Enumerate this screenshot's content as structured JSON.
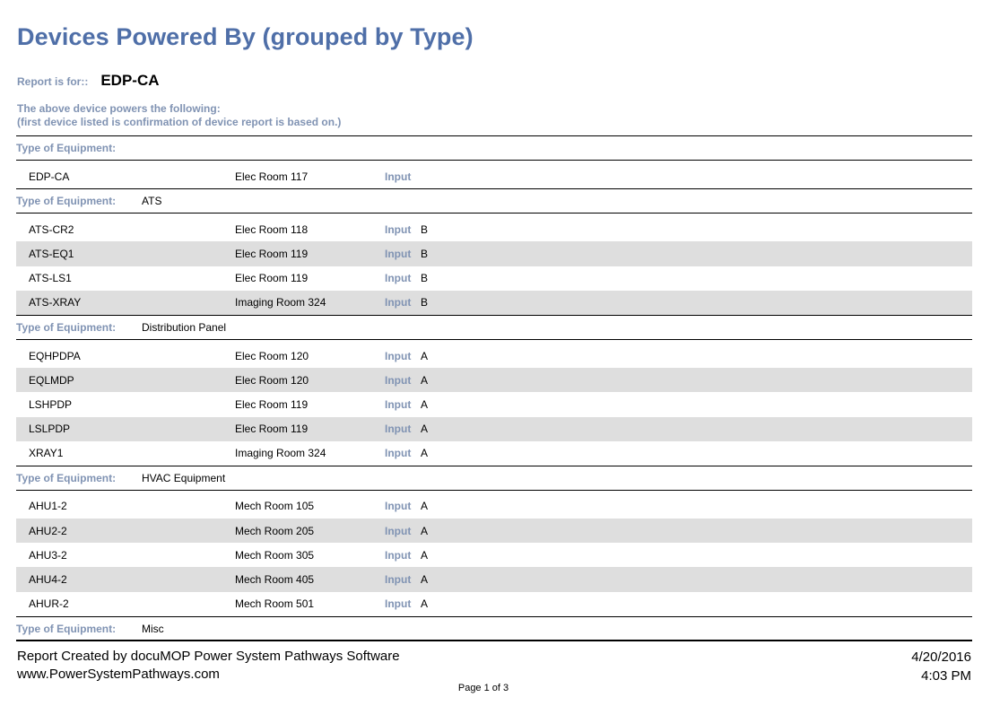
{
  "report": {
    "title": "Devices Powered By (grouped by Type)",
    "report_for_label": "Report is for::",
    "report_for_value": "EDP-CA",
    "note_line1": "The above device powers the following:",
    "note_line2": "(first device listed is confirmation of device report is based on.)"
  },
  "type_label": "Type of Equipment:",
  "input_label": "Input",
  "groups": [
    {
      "type": "",
      "rows": [
        {
          "name": "EDP-CA",
          "location": "Elec Room 117",
          "side": ""
        }
      ]
    },
    {
      "type": "ATS",
      "rows": [
        {
          "name": "ATS-CR2",
          "location": "Elec Room 118",
          "side": "B"
        },
        {
          "name": "ATS-EQ1",
          "location": "Elec Room 119",
          "side": "B"
        },
        {
          "name": "ATS-LS1",
          "location": "Elec Room 119",
          "side": "B"
        },
        {
          "name": "ATS-XRAY",
          "location": "Imaging Room 324",
          "side": "B"
        }
      ]
    },
    {
      "type": "Distribution Panel",
      "rows": [
        {
          "name": "EQHPDPA",
          "location": "Elec Room 120",
          "side": "A"
        },
        {
          "name": "EQLMDP",
          "location": "Elec Room 120",
          "side": "A"
        },
        {
          "name": "LSHPDP",
          "location": "Elec Room 119",
          "side": "A"
        },
        {
          "name": "LSLPDP",
          "location": "Elec Room 119",
          "side": "A"
        },
        {
          "name": "XRAY1",
          "location": "Imaging Room 324",
          "side": "A"
        }
      ]
    },
    {
      "type": "HVAC Equipment",
      "rows": [
        {
          "name": "AHU1-2",
          "location": "Mech Room 105",
          "side": "A"
        },
        {
          "name": "AHU2-2",
          "location": "Mech Room 205",
          "side": "A"
        },
        {
          "name": "AHU3-2",
          "location": "Mech Room 305",
          "side": "A"
        },
        {
          "name": "AHU4-2",
          "location": "Mech Room 405",
          "side": "A"
        },
        {
          "name": "AHUR-2",
          "location": "Mech Room 501",
          "side": "A"
        }
      ]
    },
    {
      "type": "Misc",
      "rows": []
    }
  ],
  "footer": {
    "created_by": "Report Created by docuMOP Power System Pathways Software",
    "website": "www.PowerSystemPathways.com",
    "date": "4/20/2016",
    "time": "4:03 PM",
    "page": "Page 1 of 3"
  }
}
